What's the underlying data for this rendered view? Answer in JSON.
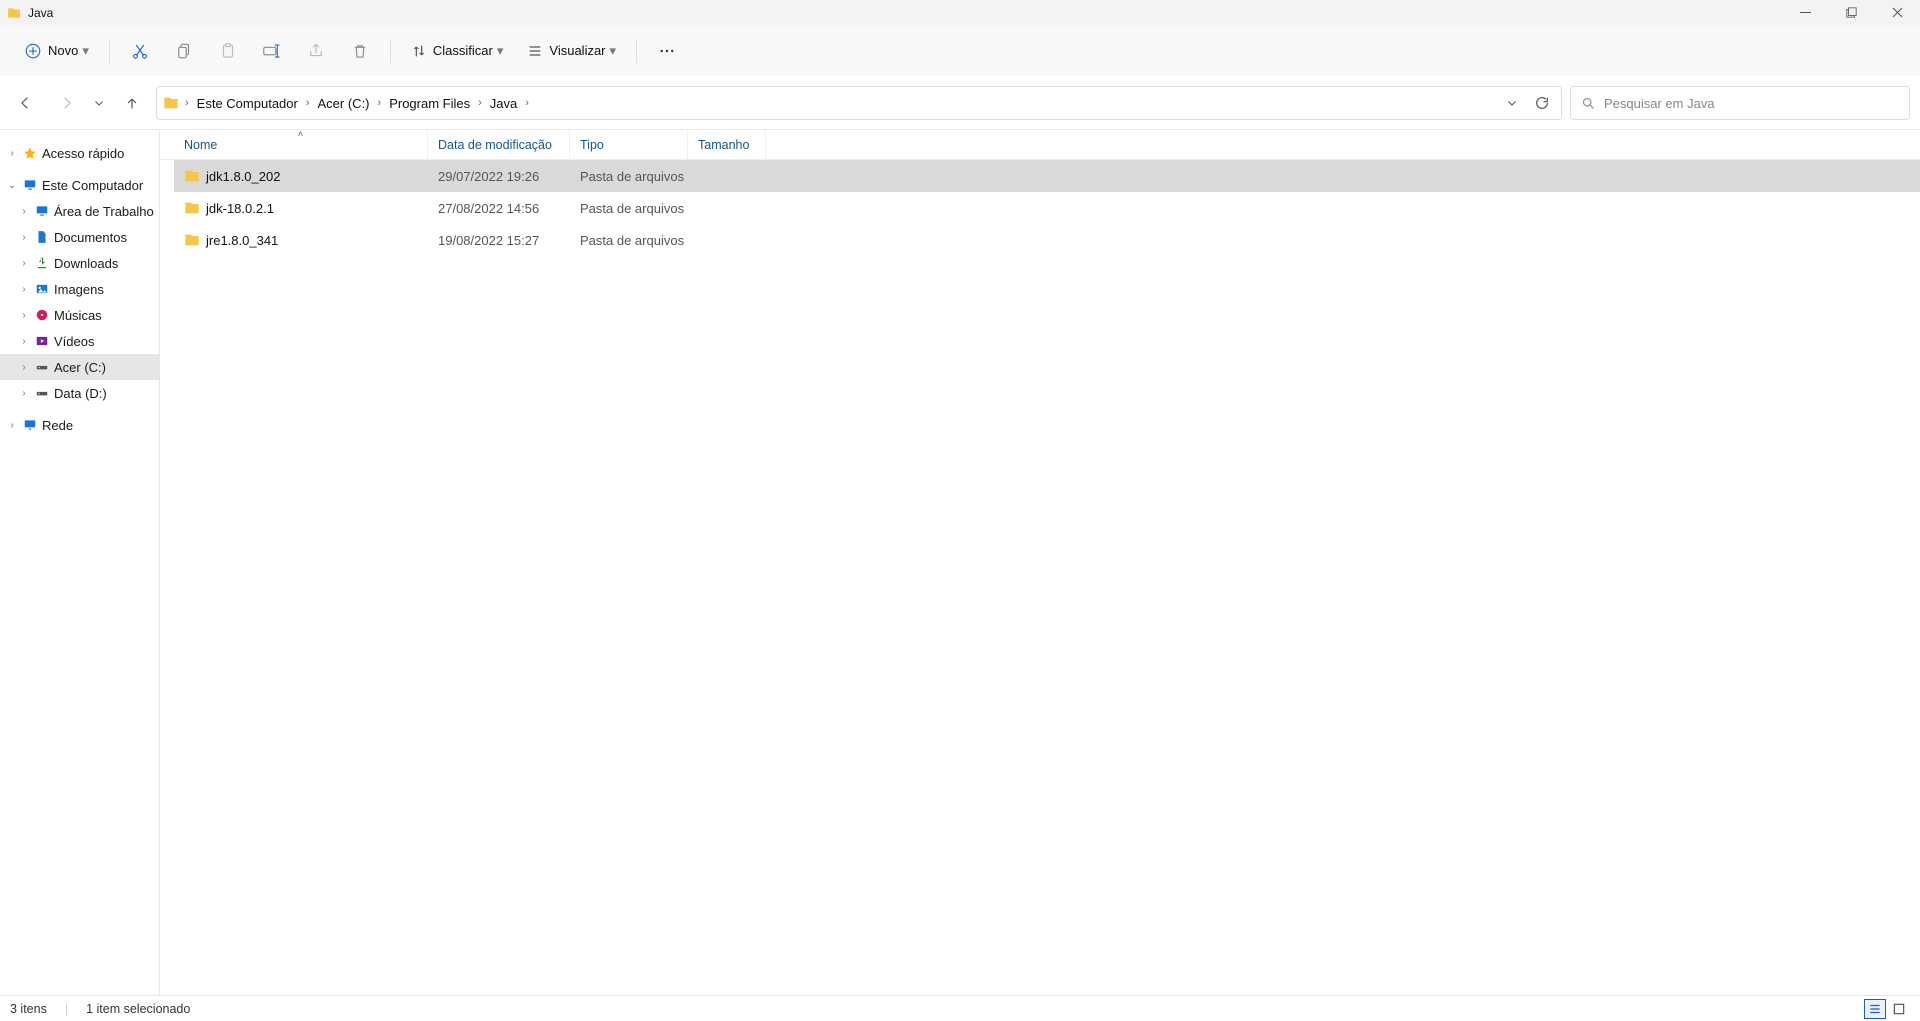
{
  "window": {
    "title": "Java"
  },
  "toolbar": {
    "new_label": "Novo",
    "sort_label": "Classificar",
    "view_label": "Visualizar"
  },
  "breadcrumbs": [
    "Este Computador",
    "Acer (C:)",
    "Program Files",
    "Java"
  ],
  "search": {
    "placeholder": "Pesquisar em Java"
  },
  "sidebar": {
    "quick_access": "Acesso rápido",
    "this_pc": "Este Computador",
    "items": [
      {
        "label": "Área de Trabalho",
        "kind": "monitor"
      },
      {
        "label": "Documentos",
        "kind": "doc"
      },
      {
        "label": "Downloads",
        "kind": "down"
      },
      {
        "label": "Imagens",
        "kind": "pic"
      },
      {
        "label": "Músicas",
        "kind": "music"
      },
      {
        "label": "Vídeos",
        "kind": "video"
      },
      {
        "label": "Acer (C:)",
        "kind": "drive",
        "selected": true
      },
      {
        "label": "Data (D:)",
        "kind": "drive"
      }
    ],
    "network": "Rede"
  },
  "columns": {
    "name": "Nome",
    "date": "Data de modificação",
    "type": "Tipo",
    "size": "Tamanho"
  },
  "rows": [
    {
      "name": "jdk1.8.0_202",
      "date": "29/07/2022 19:26",
      "type": "Pasta de arquivos",
      "size": "",
      "selected": true
    },
    {
      "name": "jdk-18.0.2.1",
      "date": "27/08/2022 14:56",
      "type": "Pasta de arquivos",
      "size": ""
    },
    {
      "name": "jre1.8.0_341",
      "date": "19/08/2022 15:27",
      "type": "Pasta de arquivos",
      "size": ""
    }
  ],
  "status": {
    "count": "3 itens",
    "selection": "1 item selecionado"
  }
}
